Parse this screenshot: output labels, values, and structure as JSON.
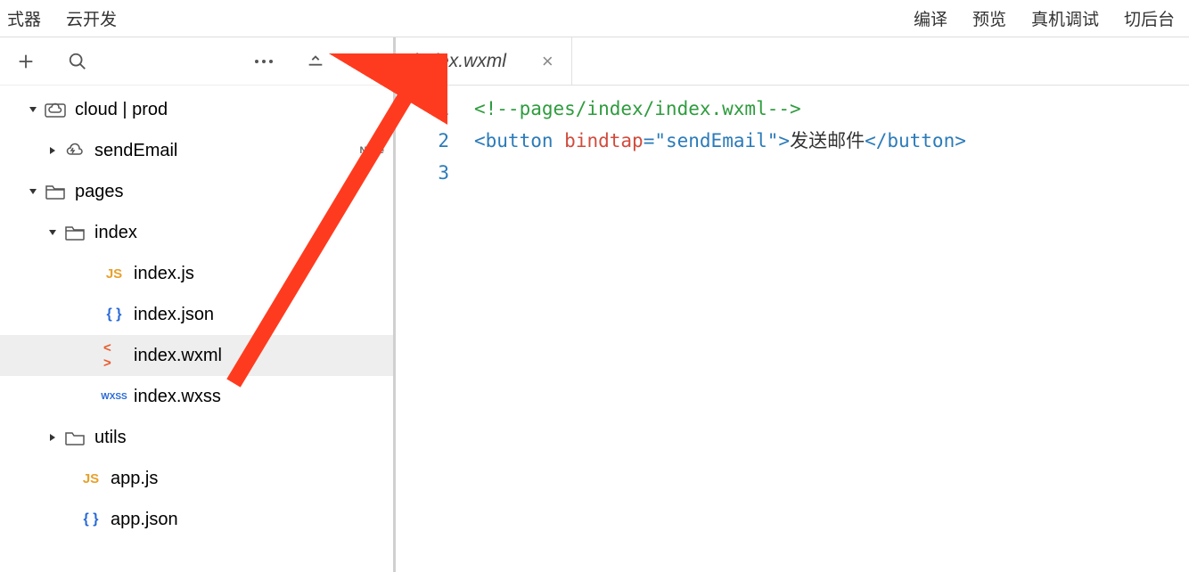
{
  "top_menu": {
    "left": [
      "式器",
      "云开发"
    ],
    "right": [
      "编译",
      "预览",
      "真机调试",
      "切后台"
    ]
  },
  "sidebar": {
    "tree": [
      {
        "label": "cloud | prod",
        "indent": 0,
        "arrow": "down",
        "icon": "cloud-folder"
      },
      {
        "label": "sendEmail",
        "indent": 1,
        "arrow": "right",
        "icon": "cloud-func",
        "badge": "Node"
      },
      {
        "label": "pages",
        "indent": 0,
        "arrow": "down",
        "icon": "folder-open"
      },
      {
        "label": "index",
        "indent": 1,
        "arrow": "down",
        "icon": "folder-open"
      },
      {
        "label": "index.js",
        "indent": 3,
        "arrow": "",
        "icon": "js"
      },
      {
        "label": "index.json",
        "indent": 3,
        "arrow": "",
        "icon": "json"
      },
      {
        "label": "index.wxml",
        "indent": 3,
        "arrow": "",
        "icon": "wxml",
        "selected": true
      },
      {
        "label": "index.wxss",
        "indent": 3,
        "arrow": "",
        "icon": "wxss"
      },
      {
        "label": "utils",
        "indent": 1,
        "arrow": "right",
        "icon": "folder"
      },
      {
        "label": "app.js",
        "indent": 2,
        "arrow": "",
        "icon": "js"
      },
      {
        "label": "app.json",
        "indent": 2,
        "arrow": "",
        "icon": "json"
      }
    ]
  },
  "editor": {
    "tab": {
      "label": "index.wxml"
    },
    "lines": [
      {
        "n": "1",
        "html": "<span class='tok-comment'>&lt;!--pages/index/index.wxml--&gt;</span>"
      },
      {
        "n": "2",
        "html": "<span class='tok-tag'>&lt;button</span> <span class='tok-attr'>bindtap</span><span class='tok-tag'>=</span><span class='tok-string'>\"sendEmail\"</span><span class='tok-tag'>&gt;</span><span class='tok-text'>发送邮件</span><span class='tok-tag'>&lt;/button&gt;</span>"
      },
      {
        "n": "3",
        "html": ""
      }
    ]
  }
}
